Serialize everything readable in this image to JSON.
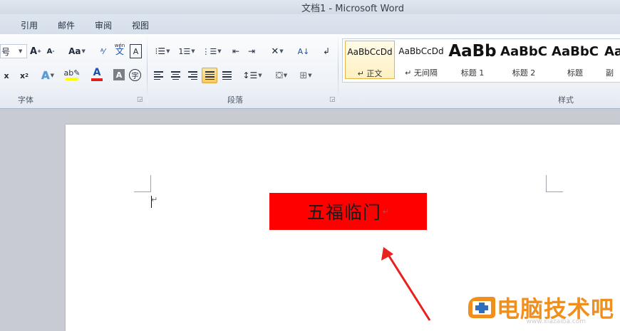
{
  "window": {
    "title": "文档1 - Microsoft Word"
  },
  "tabs": [
    "引用",
    "邮件",
    "审阅",
    "视图"
  ],
  "font_group": {
    "label": "字体",
    "size_fragment": "号",
    "change_case": "Aa",
    "phonetic_glyph": "wén",
    "char_border": "A",
    "enclose_char": "字"
  },
  "paragraph_group": {
    "label": "段落"
  },
  "styles_group": {
    "label": "样式",
    "items": [
      {
        "sample": "AaBbCcDd",
        "name": "↵ 正文",
        "selected": true
      },
      {
        "sample": "AaBbCcDd",
        "name": "↵ 无间隔",
        "selected": false
      },
      {
        "sample": "AaBb",
        "name": "标题 1",
        "selected": false
      },
      {
        "sample": "AaBbC",
        "name": "标题 2",
        "selected": false
      },
      {
        "sample": "AaBbC",
        "name": "标题",
        "selected": false
      },
      {
        "sample": "Aa",
        "name": "副",
        "selected": false
      }
    ]
  },
  "document": {
    "cursor_mark": "↵",
    "red_box_text": "五福临门",
    "paragraph_mark": "↵",
    "red_box_color": "#ff0000"
  },
  "watermark": {
    "text": "电脑技术吧",
    "url": "www.xiazaiba.com",
    "color": "#f08f1b"
  },
  "colors": {
    "arrow": "#e8201e",
    "font_color_bar": "#e02020",
    "highlight_bar": "#ffff00"
  }
}
